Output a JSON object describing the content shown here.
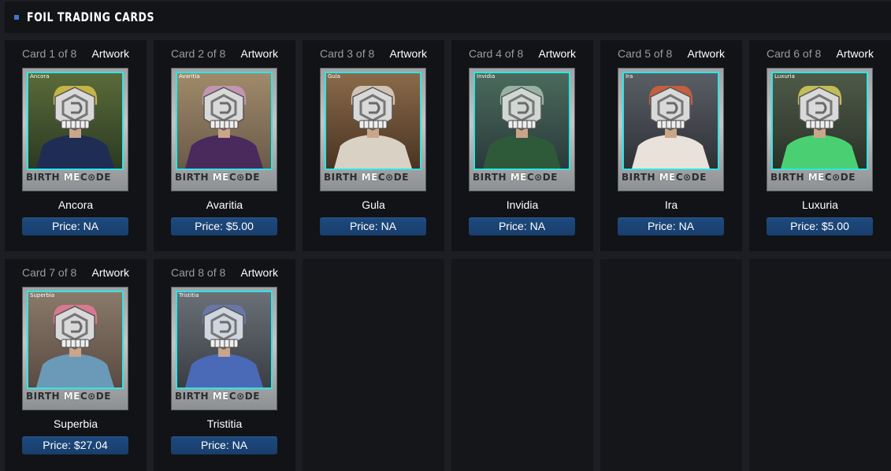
{
  "header": {
    "title": "FOIL TRADING CARDS"
  },
  "colors": {
    "accent": "#3f77c9",
    "card_border": "#2ee6e6",
    "price_button": "#1b4476"
  },
  "cards": [
    {
      "counter": "Card 1 of 8",
      "artwork": "Artwork",
      "art_label": "Ancora",
      "name": "Ancora",
      "price": "Price: NA",
      "brand_left": "BIRTH",
      "brand_mid": "ME",
      "brand_right": "C⊙DE",
      "palette": "ancora"
    },
    {
      "counter": "Card 2 of 8",
      "artwork": "Artwork",
      "art_label": "Avaritia",
      "name": "Avaritia",
      "price": "Price: $5.00",
      "brand_left": "BIRTH",
      "brand_mid": "ME",
      "brand_right": "C⊙DE",
      "palette": "avaritia"
    },
    {
      "counter": "Card 3 of 8",
      "artwork": "Artwork",
      "art_label": "Gula",
      "name": "Gula",
      "price": "Price: NA",
      "brand_left": "BIRTH",
      "brand_mid": "ME",
      "brand_right": "C⊙DE",
      "palette": "gula"
    },
    {
      "counter": "Card 4 of 8",
      "artwork": "Artwork",
      "art_label": "Invidia",
      "name": "Invidia",
      "price": "Price: NA",
      "brand_left": "BIRTH",
      "brand_mid": "ME",
      "brand_right": "C⊙DE",
      "palette": "invidia"
    },
    {
      "counter": "Card 5 of 8",
      "artwork": "Artwork",
      "art_label": "Ira",
      "name": "Ira",
      "price": "Price: NA",
      "brand_left": "BIRTH",
      "brand_mid": "ME",
      "brand_right": "C⊙DE",
      "palette": "ira"
    },
    {
      "counter": "Card 6 of 8",
      "artwork": "Artwork",
      "art_label": "Luxuria",
      "name": "Luxuria",
      "price": "Price: $5.00",
      "brand_left": "BIRTH",
      "brand_mid": "ME",
      "brand_right": "C⊙DE",
      "palette": "luxuria"
    },
    {
      "counter": "Card 7 of 8",
      "artwork": "Artwork",
      "art_label": "Superbia",
      "name": "Superbia",
      "price": "Price: $27.04",
      "brand_left": "BIRTH",
      "brand_mid": "ME",
      "brand_right": "C⊙DE",
      "palette": "superbia"
    },
    {
      "counter": "Card 8 of 8",
      "artwork": "Artwork",
      "art_label": "Tristitia",
      "name": "Tristitia",
      "price": "Price: NA",
      "brand_left": "BIRTH",
      "brand_mid": "ME",
      "brand_right": "C⊙DE",
      "palette": "tristitia"
    }
  ]
}
